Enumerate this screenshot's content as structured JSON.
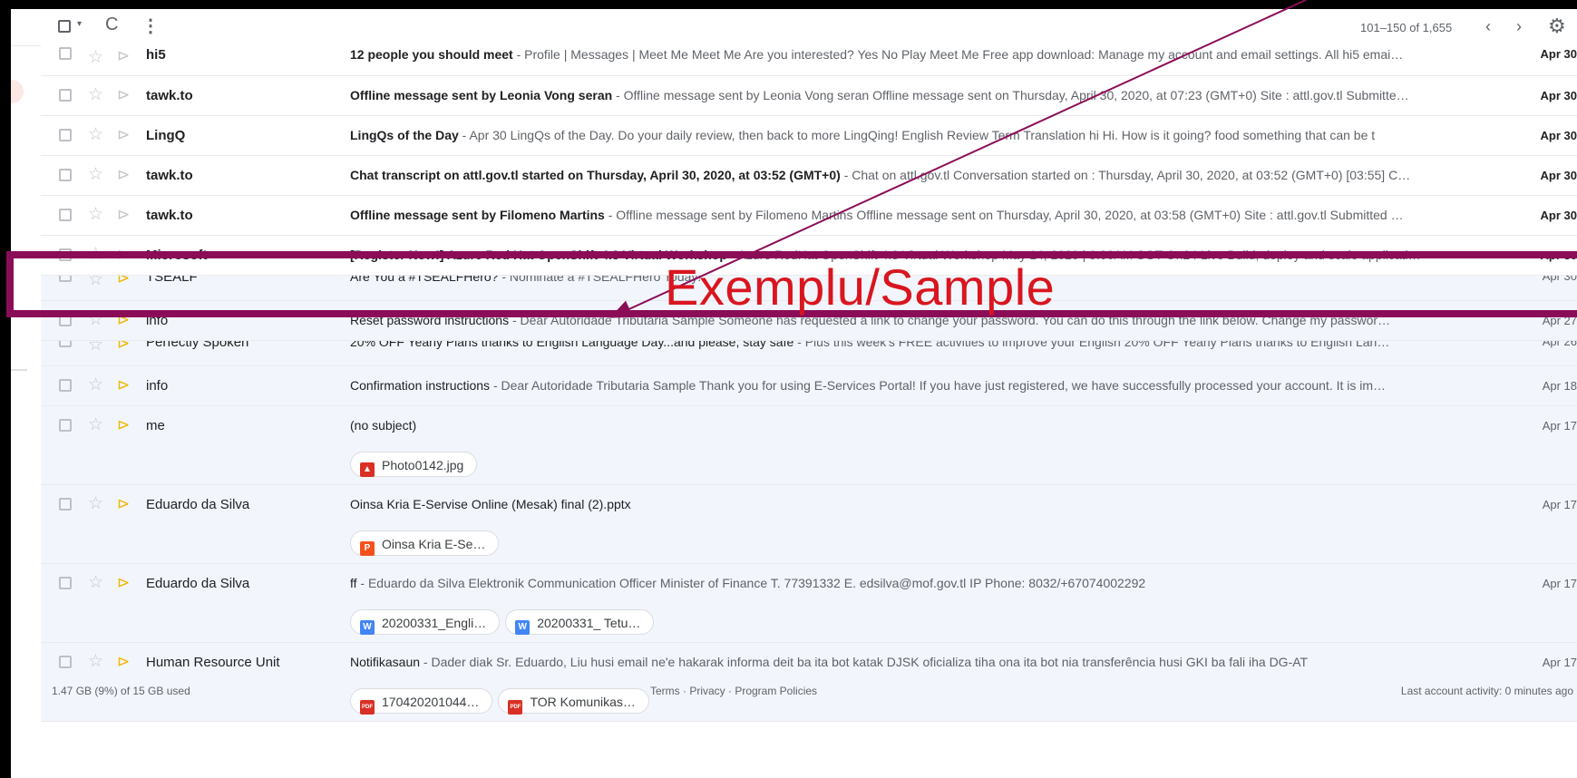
{
  "toolbar": {
    "select_caret": "▾",
    "refresh_icon": "C",
    "more_icon": "⋮",
    "range": "101–150 of 1,655",
    "prev": "‹",
    "next": "›",
    "settings_icon": "⚙"
  },
  "icons": {
    "star": "☆",
    "important_marker": "⊳"
  },
  "rows": [
    {
      "sender": "hi5",
      "subject": "12 people you should meet",
      "snippet": " - Profile | Messages | Meet Me Meet Me Are you interested? Yes No Play Meet Me Free app download: Manage my account and email settings. All hi5 emai…",
      "date": "Apr 30",
      "unread": true
    },
    {
      "sender": "tawk.to",
      "subject": "Offline message sent by Leonia Vong seran",
      "snippet": " - Offline message sent by Leonia Vong seran Offline message sent on Thursday, April 30, 2020, at 07:23 (GMT+0) Site : attl.gov.tl Submitte…",
      "date": "Apr 30",
      "unread": true
    },
    {
      "sender": "LingQ",
      "subject": "LingQs of the Day",
      "snippet": " - Apr 30 LingQs of the Day. Do your daily review, then back to more LingQing! English Review Term Translation hi Hi. How is it going? food something that can be t",
      "date": "Apr 30",
      "unread": true
    },
    {
      "sender": "tawk.to",
      "subject": "Chat transcript on attl.gov.tl started on Thursday, April 30, 2020, at 03:52 (GMT+0)",
      "snippet": " - Chat on attl.gov.tl Conversation started on : Thursday, April 30, 2020, at 03:52 (GMT+0) [03:55] C…",
      "date": "Apr 30",
      "unread": true
    },
    {
      "sender": "tawk.to",
      "subject": "Offline message sent by Filomeno Martins",
      "snippet": " - Offline message sent by Filomeno Martins Offline message sent on Thursday, April 30, 2020, at 03:58 (GMT+0) Site : attl.gov.tl Submitted …",
      "date": "Apr 30",
      "unread": true
    },
    {
      "sender": "Microsoft",
      "subject": "[Register Now!] Azure Red Hat OpenShift 4.3 Virtual Workshop",
      "snippet": " - Azure RedHat OpenShift 4.3 Virtual Workshop May 14, 2020 | 9:00AM SGT On24 Live Build, deploy and scale applicati…",
      "date": "Apr 30",
      "unread": true
    },
    {
      "sender": "TSEALF",
      "subject": "Are You a #TSEALFHero?",
      "snippet": " - Nominate a #TSEALFHero Today!",
      "date": "Apr 30",
      "unread": false
    },
    {
      "sender": "info",
      "subject": "Reset password instructions",
      "snippet": " - Dear Autoridade Tributaria Sample Someone has requested a link to change your password. You can do this through the link below. Change my passwor…",
      "date": "Apr 27",
      "unread": false
    },
    {
      "sender": "Perfectly Spoken",
      "subject": "20% OFF Yearly Plans thanks to English Language Day...and please, stay safe",
      "snippet": " - Plus this week's FREE activities to improve your English 20% OFF Yearly Plans thanks to English Lan…",
      "date": "Apr 26",
      "unread": false
    },
    {
      "sender": "info",
      "subject": "Confirmation instructions",
      "snippet": " - Dear Autoridade Tributaria Sample Thank you for using E-Services Portal! If you have just registered, we have successfully processed your account. It is im…",
      "date": "Apr 18",
      "unread": false
    },
    {
      "sender": "me",
      "subject": "(no subject)",
      "snippet": "",
      "date": "Apr 17",
      "unread": false,
      "attachments": [
        {
          "type": "img",
          "name": "Photo0142.jpg"
        }
      ]
    },
    {
      "sender": "Eduardo da Silva",
      "subject": "Oinsa Kria E-Servise Online (Mesak) final (2).pptx",
      "snippet": "",
      "date": "Apr 17",
      "unread": false,
      "attachments": [
        {
          "type": "ppt",
          "name": "Oinsa Kria E-Se…"
        }
      ]
    },
    {
      "sender": "Eduardo da Silva",
      "subject": "ff",
      "snippet": " - Eduardo da Silva Elektronik Communication Officer Minister of Finance T. 77391332 E. edsilva@mof.gov.tl IP Phone: 8032/+67074002292",
      "date": "Apr 17",
      "unread": false,
      "attachments": [
        {
          "type": "doc",
          "name": "20200331_Engli…"
        },
        {
          "type": "doc",
          "name": "20200331_ Tetu…"
        }
      ]
    },
    {
      "sender": "Human Resource Unit",
      "subject": "Notifikasaun",
      "snippet": " - Dader diak Sr. Eduardo, Liu husi email ne'e hakarak informa deit ba ita bot katak DJSK oficializa tiha ona ita bot nia transferência husi GKI ba fali iha DG-AT",
      "date": "Apr 17",
      "unread": false,
      "attachments": [
        {
          "type": "pdf",
          "name": "170420201044…"
        },
        {
          "type": "pdf",
          "name": "TOR Komunikas…"
        }
      ]
    }
  ],
  "footer": {
    "storage": "1.47 GB (9%) of 15 GB used",
    "links": "Terms · Privacy · Program Policies",
    "activity": "Last account activity: 0 minutes ago"
  },
  "overlay": {
    "label": "Exemplu/Sample",
    "color": "#8b0d57",
    "text_color": "#d9161f"
  },
  "file_icon_colors": {
    "img": "#d93025",
    "ppt": "#f4511e",
    "doc": "#4285f4",
    "pdf": "#d93025"
  },
  "file_icon_glyphs": {
    "img": "▲",
    "ppt": "P",
    "doc": "W",
    "pdf": "PDF"
  }
}
